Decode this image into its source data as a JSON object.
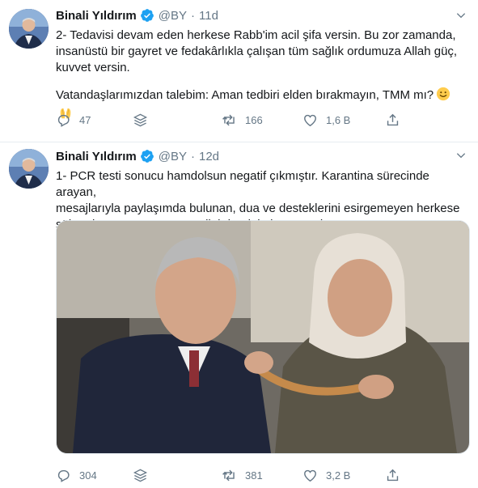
{
  "tweets": [
    {
      "name": "Binali Yıldırım",
      "handle": "@BY",
      "separator": "·",
      "time": "11d",
      "text_line1": "2- Tedavisi devam eden herkese Rabb'im acil şifa versin. Bu zor zamanda,\ninsanüstü bir gayret ve fedakârlıkla çalışan tüm sağlık ordumuza Allah güç,\nkuvvet versin.",
      "text_line2": "Vatandaşlarımızdan talebim: Aman tedbiri elden bırakmayın, TMM mı?",
      "replies": "47",
      "retweets": "166",
      "likes": "1,6 B"
    },
    {
      "name": "Binali Yıldırım",
      "handle": "@BY",
      "separator": "·",
      "time": "12d",
      "text": "1- PCR testi sonucu hamdolsun negatif çıkmıştır. Karantina sürecinde arayan,\nmesajlarıyla paylaşımda bulunan, dua ve desteklerini esirgemeyen herkese\nşükranlarımızı sunuyoruz. Allah hepinizden razı olsun.",
      "replies": "304",
      "retweets": "381",
      "likes": "3,2 B"
    }
  ],
  "colors": {
    "text": "#14171a",
    "muted": "#657786",
    "verified": "#1da1f2",
    "border": "#e6ecf0"
  },
  "icons": [
    "verified-badge-icon",
    "chevron-down-icon",
    "reply-icon",
    "stack-share-icon",
    "retweet-icon",
    "like-icon",
    "share-icon",
    "smile-emoji-icon",
    "hands-emoji-icon"
  ]
}
